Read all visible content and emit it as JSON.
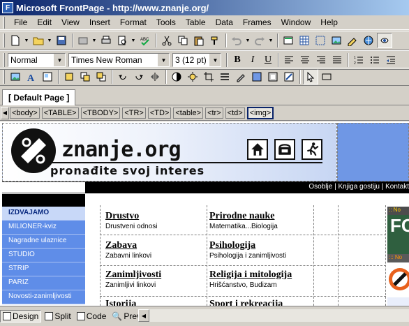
{
  "window": {
    "title": "Microsoft FrontPage - http://www.znanje.org/"
  },
  "menu": [
    "File",
    "Edit",
    "View",
    "Insert",
    "Format",
    "Tools",
    "Table",
    "Data",
    "Frames",
    "Window",
    "Help"
  ],
  "format_toolbar": {
    "style": "Normal",
    "font": "Times New Roman",
    "size": "3  (12 pt)"
  },
  "tab": {
    "label": "[ Default Page ]"
  },
  "quick_tags": [
    "<body>",
    "<TABLE>",
    "<TBODY>",
    "<TR>",
    "<TD>",
    "<table>",
    "<tr>",
    "<td>",
    "<img>"
  ],
  "page": {
    "logo_text": "znanje.org",
    "tagline": "pronađite svoj interes",
    "top_nav": "Osoblje | Knjiga gostiju | Kontakt",
    "sidebar_items": [
      "IZDVAJAMO",
      "MILIONER-kviz",
      "Nagradne ulaznice",
      "STUDIO",
      "STRIP",
      "PARIZ",
      "Novosti-zanimljivosti"
    ],
    "categories": [
      {
        "title": "Drustvo",
        "sub": "Drustveni odnosi"
      },
      {
        "title": "Prirodne nauke",
        "sub": "Matematika...Biologija"
      },
      {
        "title": "Zabava",
        "sub": "Zabavni linkovi"
      },
      {
        "title": "Psihologija",
        "sub": "Psihologija i zanimljivosti"
      },
      {
        "title": "Zanimljivosti",
        "sub": "Zanimljivi linkovi"
      },
      {
        "title": "Religija i mitologija",
        "sub": "Hrišćanstvo, Budizam"
      },
      {
        "title": "Istorija",
        "sub": ""
      },
      {
        "title": "Sport i rekreacija",
        "sub": ""
      }
    ],
    "news_head_1": ":: No",
    "news_img_text": "FC",
    "news_head_2": "::: No"
  },
  "views": {
    "design": "Design",
    "split": "Split",
    "code": "Code",
    "preview": "Preview"
  },
  "colors": {
    "title_start": "#0a246a",
    "title_end": "#a6caf0",
    "sidebar": "#5f8de8",
    "header_band": "#6f97e5"
  }
}
